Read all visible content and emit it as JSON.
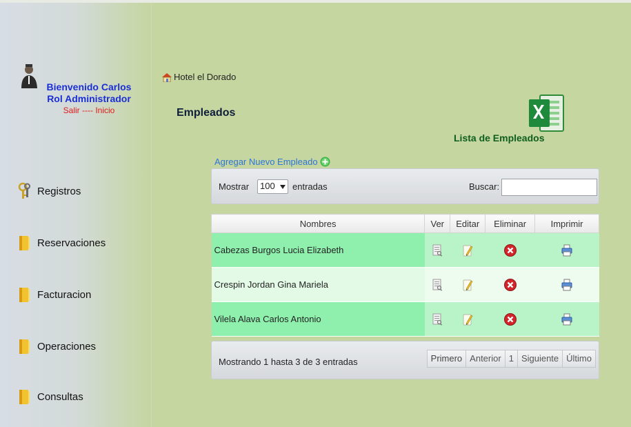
{
  "sidebar": {
    "welcome": "Bienvenido Carlos",
    "role": "Rol Administrador",
    "logout": "Salir",
    "separator": "----",
    "home": "Inicio",
    "menu": [
      {
        "label": "Registros",
        "icon": "keys-icon"
      },
      {
        "label": "Reservaciones",
        "icon": "folder-icon"
      },
      {
        "label": "Facturacion",
        "icon": "folder-icon"
      },
      {
        "label": "Operaciones",
        "icon": "folder-icon"
      },
      {
        "label": "Consultas",
        "icon": "folder-icon"
      }
    ]
  },
  "main": {
    "breadcrumb": "Hotel el Dorado",
    "title": "Empleados",
    "excel_label": "Lista de Empleados",
    "add_link": "Agregar Nuevo Empleado",
    "table": {
      "show_label": "Mostrar",
      "page_length": "100",
      "entries_label": "entradas",
      "search_label": "Buscar:",
      "search_value": "",
      "columns": [
        "Nombres",
        "Ver",
        "Editar",
        "Eliminar",
        "Imprimir"
      ],
      "rows": [
        {
          "name": "Cabezas Burgos Lucia Elizabeth"
        },
        {
          "name": "Crespin Jordan Gina Mariela"
        },
        {
          "name": "Vilela Alava Carlos Antonio"
        }
      ],
      "info": "Mostrando 1 hasta 3 de 3 entradas",
      "pager": {
        "first": "Primero",
        "prev": "Anterior",
        "page": "1",
        "next": "Siguiente",
        "last": "Último"
      }
    }
  },
  "colors": {
    "background": "#c5d6a0",
    "row_odd": "#8ff0ae",
    "row_even": "#e3fbe6",
    "link_blue": "#1a2ed6",
    "logout_red": "#e0191b"
  }
}
